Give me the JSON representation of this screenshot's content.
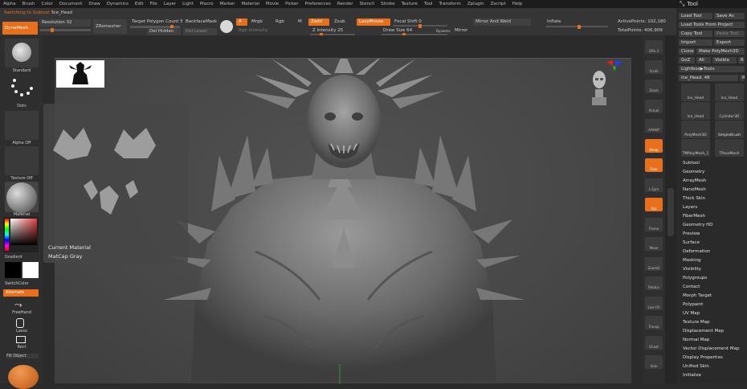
{
  "menu": [
    "Alpha",
    "Brush",
    "Color",
    "Document",
    "Draw",
    "Dynamics",
    "Edit",
    "File",
    "Layer",
    "Light",
    "Macro",
    "Marker",
    "Material",
    "Movie",
    "Picker",
    "Preferences",
    "Render",
    "Stencil",
    "Stroke",
    "Texture",
    "Tool",
    "Transform",
    "Zplugin",
    "Zscript",
    "Help"
  ],
  "tool_title": "Tool",
  "status": "Switching to Subtool 5:",
  "status_tool": "Ice_Head",
  "topbar": {
    "dynamesh": "DynaMesh",
    "resolution": "Resolution 32",
    "zremesher": "ZRemesher",
    "target_polygon": "Target Polygon Count 5",
    "backface_mask": "BackfaceMask",
    "del_hidden": "Del Hidden",
    "del_lower": "Del Lower",
    "a": "A",
    "mrgb": "Mrgb",
    "rgb": "Rgb",
    "m": "M",
    "zadd": "Zadd",
    "zsub": "Zsub",
    "rgb_intensity": "Rgb Intensity",
    "z_intensity": "Z Intensity 25",
    "lazymouse": "LazyMouse",
    "focal_shift": "Focal Shift 0",
    "draw_size": "Draw Size 64",
    "dynamic": "Dynamic",
    "mirror_and_weld": "Mirror And Weld",
    "mirror": "Mirror",
    "inflate": "Inflate",
    "active_points": "ActivePoints: 102,180",
    "total_points": "TotalPoints: 406,909"
  },
  "left": {
    "brush": "Standard",
    "stroke": "Dots",
    "alpha": "Alpha Off",
    "texture": "Texture Off",
    "material": "Material",
    "gradient": "Gradient",
    "switch_color": "SwitchColor",
    "alternate": "Alternate",
    "lasso": "FreeHand",
    "lasso2": "Lasso",
    "rect": "Rect",
    "fill": "Fill Object"
  },
  "viewport": {
    "current_material_label": "Current Material",
    "current_material_value": "MatCap Gray"
  },
  "shelf": [
    {
      "label": "SPix 3"
    },
    {
      "label": "Scroll"
    },
    {
      "label": "Zoom"
    },
    {
      "label": "Actual"
    },
    {
      "label": "AAHalf"
    },
    {
      "label": "Persp"
    },
    {
      "label": "Floor"
    },
    {
      "label": "L.Sym"
    },
    {
      "label": "Xyz"
    },
    {
      "label": "Frame"
    },
    {
      "label": "Move"
    },
    {
      "label": "ZoomD"
    },
    {
      "label": "RotaLo"
    },
    {
      "label": "Line Fill"
    },
    {
      "label": "Transp"
    },
    {
      "label": "Ghost"
    },
    {
      "label": "Solo"
    }
  ],
  "toolpanel": {
    "load_tool": "Load Tool",
    "save_as": "Save As",
    "load_from_project": "Load Tools From Project",
    "copy_tool": "Copy Tool",
    "paste_tool": "Paste Tool",
    "import": "Import",
    "export": "Export",
    "clone": "Clone",
    "make_polymesh": "Make PolyMesh3D",
    "goz": "GoZ",
    "all": "All",
    "visible": "Visible",
    "r": "R",
    "lightbox": "Lightbox▶Tools",
    "current_tool": "Ice_Head. 48",
    "r2": "R",
    "thumbs": [
      "Ice_Head",
      "Ice_Head",
      "Ice_Head",
      "Cylinder3D",
      "PolyMesh3D",
      "SimpleBrush",
      "TMPolyMesh_1",
      "TPoseMesh"
    ],
    "subpalettes": [
      "Subtool",
      "Geometry",
      "ArrayMesh",
      "NanoMesh",
      "Thick Skin",
      "Layers",
      "FiberMesh",
      "Geometry HD",
      "Preview",
      "Surface",
      "Deformation",
      "Masking",
      "Visibility",
      "Polygroups",
      "Contact",
      "Morph Target",
      "Polypaint",
      "UV Map",
      "Texture Map",
      "Displacement Map",
      "Normal Map",
      "Vector Displacement Map",
      "Display Properties",
      "Unified Skin",
      "Initialize"
    ]
  },
  "colors": {
    "accent": "#e8701c",
    "background": "#2b2b2b",
    "viewport": "#4a4a4a"
  }
}
